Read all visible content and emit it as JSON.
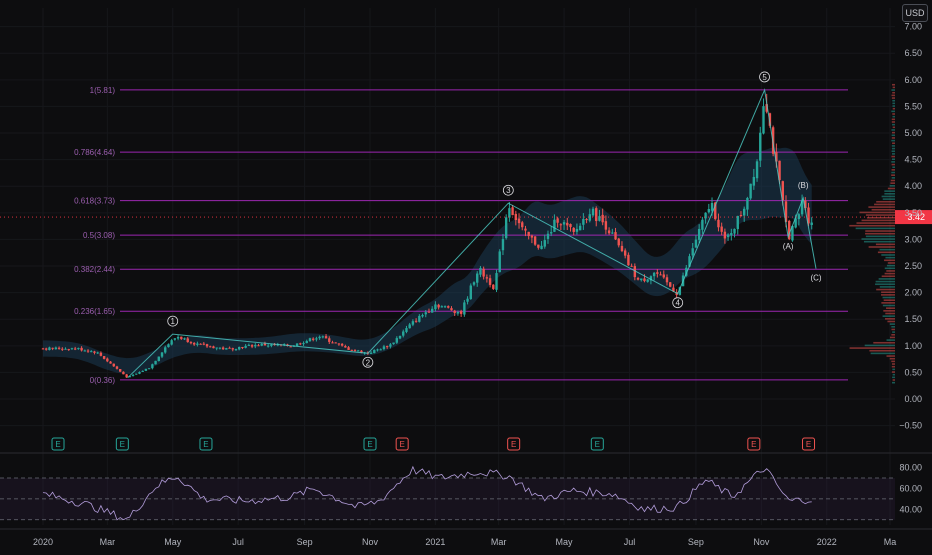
{
  "currency": "USD",
  "chart_data": [
    {
      "type": "candlestick",
      "price_axis": {
        "ticks": [
          7.0,
          6.5,
          6.0,
          5.5,
          5.0,
          4.5,
          4.0,
          3.5,
          3.0,
          2.5,
          2.0,
          1.5,
          1.0,
          0.5,
          0.0,
          -0.5
        ],
        "tick_labels": [
          "7.00",
          "6.50",
          "6.00",
          "5.50",
          "5.00",
          "4.50",
          "4.00",
          "3.50",
          "3.00",
          "2.50",
          "2.00",
          "1.50",
          "1.00",
          "0.50",
          "0.00",
          "−0.50"
        ],
        "range": [
          -0.62,
          7.35
        ]
      },
      "time_axis": {
        "labels": [
          "2020",
          "Mar",
          "May",
          "Jul",
          "Sep",
          "Nov",
          "2021",
          "Mar",
          "May",
          "Jul",
          "Sep",
          "Nov",
          "2022",
          "Ma"
        ],
        "dates": [
          "2020-01-01",
          "2020-03-01",
          "2020-05-01",
          "2020-07-01",
          "2020-09-01",
          "2020-11-01",
          "2021-01-01",
          "2021-03-01",
          "2021-05-01",
          "2021-07-01",
          "2021-09-01",
          "2021-11-01",
          "2022-01-01",
          "2022-03-01"
        ]
      },
      "current_price": 3.42,
      "fibonacci": [
        {
          "label": "1(5.81)",
          "price": 5.81
        },
        {
          "label": "0.786(4.64)",
          "price": 4.64
        },
        {
          "label": "0.618(3.73)",
          "price": 3.73
        },
        {
          "label": "0.5(3.08)",
          "price": 3.08
        },
        {
          "label": "0.382(2.44)",
          "price": 2.44
        },
        {
          "label": "0.236(1.65)",
          "price": 1.65
        },
        {
          "label": "0(0.36)",
          "price": 0.36
        }
      ],
      "waves": [
        {
          "label": "1",
          "date": "2020-05-01",
          "price": 1.22
        },
        {
          "label": "2",
          "date": "2020-10-30",
          "price": 0.86
        },
        {
          "label": "3",
          "date": "2021-03-10",
          "price": 3.68
        },
        {
          "label": "4",
          "date": "2021-08-15",
          "price": 1.98
        },
        {
          "label": "5",
          "date": "2021-11-04",
          "price": 5.81
        },
        {
          "label": "(A)",
          "date": "2021-11-26",
          "price": 3.05
        },
        {
          "label": "(B)",
          "date": "2021-12-10",
          "price": 3.78
        },
        {
          "label": "(C)",
          "date": "2021-12-22",
          "price": 2.45
        }
      ],
      "price_path": [
        {
          "date": "2020-01-01",
          "price": 0.95
        },
        {
          "date": "2020-02-01",
          "price": 0.95
        },
        {
          "date": "2020-02-20",
          "price": 0.88
        },
        {
          "date": "2020-03-20",
          "price": 0.4
        },
        {
          "date": "2020-04-10",
          "price": 0.6
        },
        {
          "date": "2020-04-25",
          "price": 1.0
        },
        {
          "date": "2020-05-05",
          "price": 1.18
        },
        {
          "date": "2020-05-25",
          "price": 1.02
        },
        {
          "date": "2020-06-20",
          "price": 0.94
        },
        {
          "date": "2020-07-20",
          "price": 1.02
        },
        {
          "date": "2020-08-20",
          "price": 1.0
        },
        {
          "date": "2020-09-15",
          "price": 1.18
        },
        {
          "date": "2020-10-10",
          "price": 0.95
        },
        {
          "date": "2020-10-30",
          "price": 0.86
        },
        {
          "date": "2020-11-20",
          "price": 1.02
        },
        {
          "date": "2020-12-10",
          "price": 1.42
        },
        {
          "date": "2021-01-01",
          "price": 1.78
        },
        {
          "date": "2021-01-25",
          "price": 1.62
        },
        {
          "date": "2021-02-10",
          "price": 2.45
        },
        {
          "date": "2021-02-25",
          "price": 2.1
        },
        {
          "date": "2021-03-10",
          "price": 3.68
        },
        {
          "date": "2021-03-25",
          "price": 3.1
        },
        {
          "date": "2021-04-10",
          "price": 2.85
        },
        {
          "date": "2021-04-25",
          "price": 3.4
        },
        {
          "date": "2021-05-10",
          "price": 3.1
        },
        {
          "date": "2021-05-25",
          "price": 3.55
        },
        {
          "date": "2021-06-10",
          "price": 3.25
        },
        {
          "date": "2021-06-25",
          "price": 2.7
        },
        {
          "date": "2021-07-10",
          "price": 2.2
        },
        {
          "date": "2021-07-25",
          "price": 2.38
        },
        {
          "date": "2021-08-15",
          "price": 1.98
        },
        {
          "date": "2021-08-30",
          "price": 2.9
        },
        {
          "date": "2021-09-15",
          "price": 3.7
        },
        {
          "date": "2021-09-28",
          "price": 2.95
        },
        {
          "date": "2021-10-15",
          "price": 3.55
        },
        {
          "date": "2021-10-28",
          "price": 4.5
        },
        {
          "date": "2021-11-04",
          "price": 5.81
        },
        {
          "date": "2021-11-12",
          "price": 4.7
        },
        {
          "date": "2021-11-20",
          "price": 3.8
        },
        {
          "date": "2021-11-26",
          "price": 3.05
        },
        {
          "date": "2021-12-05",
          "price": 3.4
        },
        {
          "date": "2021-12-10",
          "price": 3.78
        },
        {
          "date": "2021-12-16",
          "price": 3.3
        },
        {
          "date": "2021-12-20",
          "price": 3.42
        }
      ],
      "earnings_markers": [
        {
          "date": "2020-01-15",
          "label": "E",
          "type": "past"
        },
        {
          "date": "2020-03-15",
          "label": "E",
          "type": "past"
        },
        {
          "date": "2020-06-01",
          "label": "E",
          "type": "past"
        },
        {
          "date": "2020-11-01",
          "label": "E",
          "type": "past"
        },
        {
          "date": "2020-12-01",
          "label": "E",
          "type": "miss"
        },
        {
          "date": "2021-03-15",
          "label": "E",
          "type": "miss"
        },
        {
          "date": "2021-06-01",
          "label": "E",
          "type": "past"
        },
        {
          "date": "2021-10-25",
          "label": "E",
          "type": "miss"
        },
        {
          "date": "2021-12-15",
          "label": "E",
          "type": "miss"
        }
      ],
      "colors": {
        "up": "#26a69a",
        "down": "#ef5350",
        "fib": "#9c27b0",
        "wave": "#4dd0c8",
        "band": "#1c3a52",
        "price_label": "#f23645"
      }
    },
    {
      "type": "line",
      "indicator": "RSI",
      "y_axis": {
        "ticks": [
          80,
          60,
          40
        ],
        "tick_labels": [
          "80.00",
          "60.00",
          "40.00"
        ],
        "range": [
          25,
          92
        ]
      },
      "levels": [
        70,
        50,
        30
      ],
      "rsi_path": [
        {
          "date": "2020-01-01",
          "value": 55
        },
        {
          "date": "2020-02-10",
          "value": 45
        },
        {
          "date": "2020-03-20",
          "value": 30
        },
        {
          "date": "2020-04-15",
          "value": 62
        },
        {
          "date": "2020-05-05",
          "value": 72
        },
        {
          "date": "2020-05-30",
          "value": 50
        },
        {
          "date": "2020-07-10",
          "value": 48
        },
        {
          "date": "2020-08-20",
          "value": 52
        },
        {
          "date": "2020-09-10",
          "value": 60
        },
        {
          "date": "2020-10-20",
          "value": 42
        },
        {
          "date": "2020-11-10",
          "value": 48
        },
        {
          "date": "2020-12-10",
          "value": 78
        },
        {
          "date": "2021-01-05",
          "value": 70
        },
        {
          "date": "2021-02-10",
          "value": 76
        },
        {
          "date": "2021-03-10",
          "value": 72
        },
        {
          "date": "2021-04-10",
          "value": 50
        },
        {
          "date": "2021-05-10",
          "value": 58
        },
        {
          "date": "2021-06-15",
          "value": 55
        },
        {
          "date": "2021-07-15",
          "value": 40
        },
        {
          "date": "2021-08-15",
          "value": 42
        },
        {
          "date": "2021-09-10",
          "value": 68
        },
        {
          "date": "2021-10-05",
          "value": 52
        },
        {
          "date": "2021-11-04",
          "value": 80
        },
        {
          "date": "2021-11-26",
          "value": 48
        },
        {
          "date": "2021-12-20",
          "value": 50
        }
      ],
      "color": "#b39ddb"
    }
  ]
}
